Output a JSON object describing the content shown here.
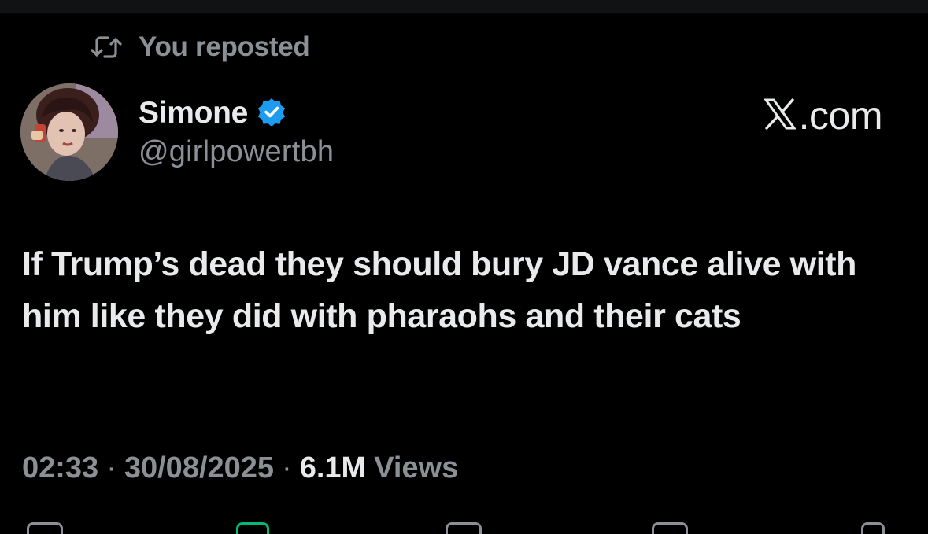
{
  "repost": {
    "icon": "repost-icon",
    "label": "You reposted"
  },
  "author": {
    "display_name": "Simone",
    "handle": "@girlpowertbh",
    "verified_icon": "verified-badge-icon",
    "avatar": "avatar-photo"
  },
  "brand": {
    "logo": "x-logo-icon",
    "domain": ".com"
  },
  "tweet": {
    "text": "If Trump’s dead they should bury JD vance alive with him like they did with pharaohs and their cats"
  },
  "meta": {
    "time": "02:33",
    "separator": "·",
    "date": "30/08/2025",
    "views_count": "6.1M",
    "views_label": "Views"
  },
  "actions": [
    "reply-icon",
    "repost-icon",
    "like-icon",
    "bookmark-icon",
    "share-icon"
  ],
  "colors": {
    "background": "#000000",
    "primary_text": "#e8eaec",
    "secondary_text": "#8b9096",
    "verified_blue": "#1d9bf0"
  }
}
